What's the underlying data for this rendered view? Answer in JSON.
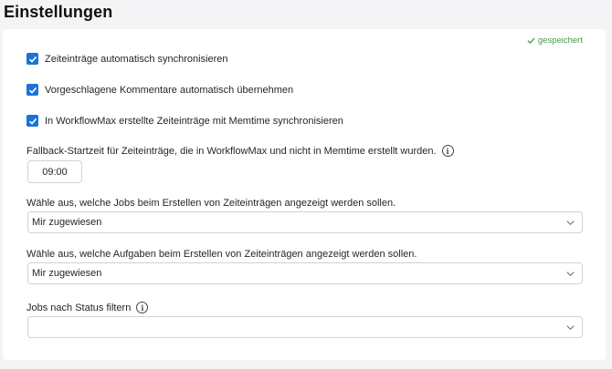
{
  "page": {
    "title": "Einstellungen"
  },
  "status": {
    "saved_label": "gespeichert"
  },
  "checkboxes": [
    {
      "label": "Zeiteinträge automatisch synchronisieren",
      "checked": true
    },
    {
      "label": "Vorgeschlagene Kommentare automatisch übernehmen",
      "checked": true
    },
    {
      "label": "In WorkflowMax erstellte Zeiteinträge mit Memtime synchronisieren",
      "checked": true
    }
  ],
  "fallback": {
    "label": "Fallback-Startzeit für Zeiteinträge, die in WorkflowMax und nicht in Memtime erstellt wurden.",
    "value": "09:00"
  },
  "jobs_select": {
    "label": "Wähle aus, welche Jobs beim Erstellen von Zeiteinträgen angezeigt werden sollen.",
    "value": "Mir zugewiesen"
  },
  "tasks_select": {
    "label": "Wähle aus, welche Aufgaben beim Erstellen von Zeiteinträgen angezeigt werden sollen.",
    "value": "Mir zugewiesen"
  },
  "status_filter": {
    "label": "Jobs nach Status filtern",
    "value": ""
  },
  "colors": {
    "accent": "#1a73d9",
    "saved": "#3f9e45",
    "border": "#cfd3d8"
  }
}
